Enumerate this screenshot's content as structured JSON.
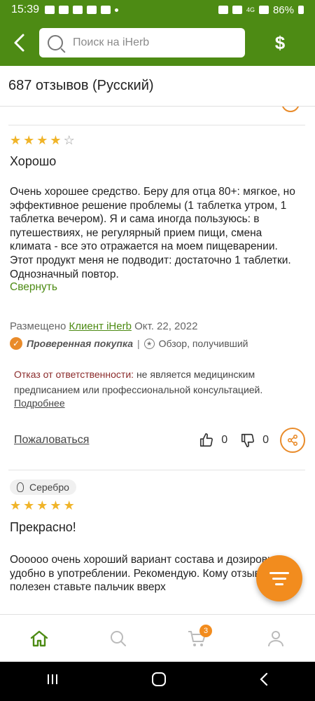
{
  "status_bar": {
    "time": "15:39",
    "battery": "86%",
    "network": "4G"
  },
  "header": {
    "back_icon": "chevron-left-icon",
    "search_placeholder": "Поиск на iHerb",
    "currency_symbol": "$"
  },
  "reviews_title": "687 отзывов (Русский)",
  "review1": {
    "rating": 4,
    "max_rating": 5,
    "title": "Хорошо",
    "body": "Очень хорошее средство. Беру для отца 80+:  мягкое, но эффективное решение проблемы (1 таблетка утром, 1 таблетка вечером). Я и сама иногда пользуюсь: в путешествиях, не регулярный прием пищи, смена климата - все это отражается на моем пищеварении. Этот продукт меня не подводит: достаточно 1 таблетки. Однозначный повтор.",
    "collapse_label": "Свернуть",
    "posted_prefix": "Размещено",
    "author": "Клиент iHerb",
    "date": "Окт. 22, 2022",
    "verified_label": "Проверенная покупка",
    "separator": "|",
    "review_type": "Обзор, получивший",
    "disclaimer_label": "Отказ от ответственности:",
    "disclaimer_text": " не является медицинским предписанием или профессиональной консультацией.",
    "more_label": "Подробнее",
    "report_label": "Пожаловаться",
    "likes": "0",
    "dislikes": "0"
  },
  "review2": {
    "badge": "Серебро",
    "rating": 5,
    "max_rating": 5,
    "title": "Прекрасно!",
    "body": "Оооооо очень хороший вариант состава и дозировки удобно в употреблении. Рекомендую. Кому отзыв полезен ставьте пальчик вверх"
  },
  "bottom_nav": {
    "cart_count": "3"
  },
  "colors": {
    "brand_green": "#4d8b14",
    "accent_orange": "#f28c1e",
    "star": "#f0b429"
  }
}
